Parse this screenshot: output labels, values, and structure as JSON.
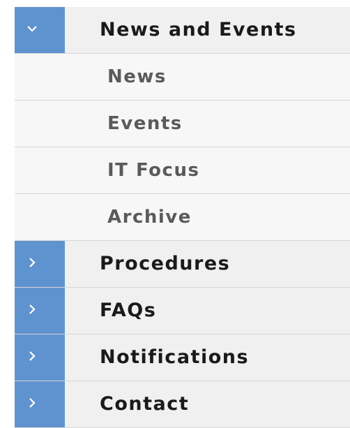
{
  "menu": {
    "section": {
      "label": "News and Events",
      "expanded": true,
      "icon": "chevron-down-icon",
      "items": [
        {
          "label": "News"
        },
        {
          "label": "Events"
        },
        {
          "label": "IT Focus"
        },
        {
          "label": "Archive"
        }
      ]
    },
    "collapsed": [
      {
        "label": "Procedures",
        "icon": "chevron-right-icon"
      },
      {
        "label": "FAQs",
        "icon": "chevron-right-icon"
      },
      {
        "label": "Notifications",
        "icon": "chevron-right-icon"
      },
      {
        "label": "Contact",
        "icon": "chevron-right-icon"
      }
    ]
  },
  "colors": {
    "accent": "#5f93cf",
    "parent_bg": "#f0f0f0",
    "sub_bg": "#f7f7f7",
    "divider": "#d6d6d6",
    "parent_text": "#1a1a1a",
    "sub_text": "#5a5a5a"
  }
}
